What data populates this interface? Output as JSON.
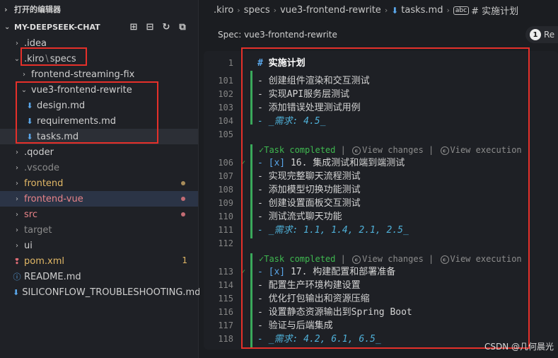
{
  "sidebar": {
    "open_editors": "打开的编辑器",
    "project": "MY-DEEPSEEK-CHAT",
    "tree": [
      {
        "label": ".idea",
        "type": "folder",
        "open": false
      },
      {
        "label": ".kiro",
        "label2": "specs",
        "type": "folder",
        "open": true
      },
      {
        "label": "frontend-streaming-fix",
        "type": "folder",
        "open": false
      },
      {
        "label": "vue3-frontend-rewrite",
        "type": "folder",
        "open": true
      },
      {
        "label": "design.md",
        "type": "md"
      },
      {
        "label": "requirements.md",
        "type": "md"
      },
      {
        "label": "tasks.md",
        "type": "md",
        "selected": true
      },
      {
        "label": ".qoder",
        "type": "folder",
        "open": false
      },
      {
        "label": ".vscode",
        "type": "folder",
        "open": false
      },
      {
        "label": "frontend",
        "type": "folder",
        "open": false
      },
      {
        "label": "frontend-vue",
        "type": "folder",
        "open": false
      },
      {
        "label": "src",
        "type": "folder",
        "open": false
      },
      {
        "label": "target",
        "type": "folder",
        "open": false
      },
      {
        "label": "ui",
        "type": "folder",
        "open": false
      },
      {
        "label": "pom.xml",
        "type": "xml",
        "badge": "1"
      },
      {
        "label": "README.md",
        "type": "info"
      },
      {
        "label": "SILICONFLOW_TROUBLESHOOTING.md",
        "type": "md"
      }
    ]
  },
  "breadcrumb": [
    "",
    ".kiro",
    "specs",
    "vue3-frontend-rewrite",
    "tasks.md",
    "# 实施计划"
  ],
  "spec_bar": {
    "label": "Spec: vue3-frontend-rewrite",
    "badge": "1",
    "badge_text": "Re"
  },
  "editor": {
    "heading": {
      "num": "1",
      "hash": "#",
      "text": "实施计划"
    },
    "lines": [
      {
        "n": "101",
        "text": "- 创建组件渲染和交互测试"
      },
      {
        "n": "102",
        "text": "- 实现API服务层测试"
      },
      {
        "n": "103",
        "text": "- 添加错误处理测试用例"
      },
      {
        "n": "104",
        "text": "- _需求: 4.5_"
      },
      {
        "n": "105",
        "text": ""
      },
      {
        "n": "106",
        "text": "- [x] 16. 集成测试和端到端测试"
      },
      {
        "n": "107",
        "text": "- 实现完整聊天流程测试"
      },
      {
        "n": "108",
        "text": "- 添加模型切换功能测试"
      },
      {
        "n": "109",
        "text": "- 创建设置面板交互测试"
      },
      {
        "n": "110",
        "text": "- 测试流式聊天功能"
      },
      {
        "n": "111",
        "text": "- _需求: 1.1, 1.4, 2.1, 2.5_"
      },
      {
        "n": "112",
        "text": ""
      },
      {
        "n": "113",
        "text": "- [x] 17. 构建配置和部署准备"
      },
      {
        "n": "114",
        "text": "- 配置生产环境构建设置"
      },
      {
        "n": "115",
        "text": "- 优化打包输出和资源压缩"
      },
      {
        "n": "116",
        "text": "- 设置静态资源输出到Spring Boot"
      },
      {
        "n": "117",
        "text": "- 验证与后端集成"
      },
      {
        "n": "118",
        "text": "- _需求: 4.2, 6.1, 6.5_"
      }
    ],
    "codelens": {
      "completed": "Task completed",
      "changes": "View changes",
      "execution": "View execution",
      "sep": "|"
    }
  },
  "watermark": "CSDN @几何晨光",
  "colors": {
    "highlight_box": "#e5302a",
    "completed": "#3fb950",
    "accent": "#5aa7ea"
  }
}
